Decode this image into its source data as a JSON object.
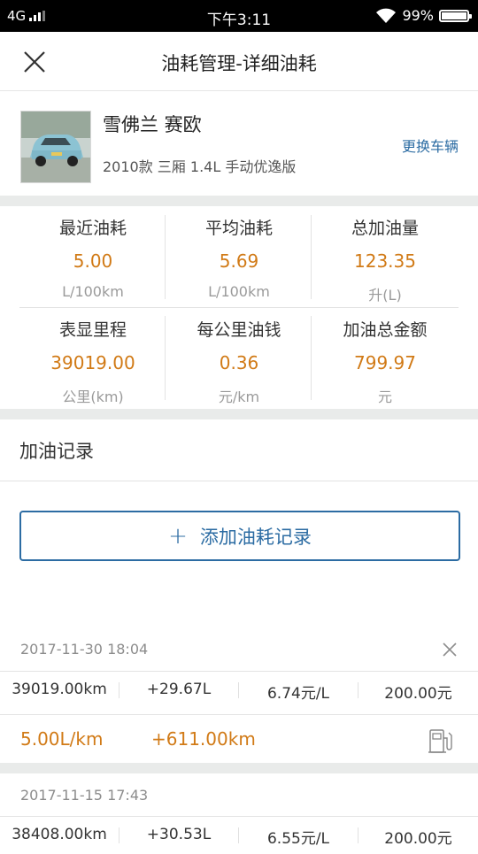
{
  "status_bar": {
    "network": "4G",
    "time": "下午3:11",
    "battery": "99%"
  },
  "header": {
    "title": "油耗管理-详细油耗"
  },
  "car": {
    "name": "雪佛兰 赛欧",
    "model": "2010款 三厢 1.4L 手动优逸版",
    "change_label": "更换车辆"
  },
  "stats": {
    "recent": {
      "label": "最近油耗",
      "value": "5.00",
      "unit": "L/100km"
    },
    "average": {
      "label": "平均油耗",
      "value": "5.69",
      "unit": "L/100km"
    },
    "total_fuel": {
      "label": "总加油量",
      "value": "123.35",
      "unit": "升(L)"
    },
    "odometer": {
      "label": "表显里程",
      "value": "39019.00",
      "unit": "公里(km)"
    },
    "cost_per_km": {
      "label": "每公里油钱",
      "value": "0.36",
      "unit": "元/km"
    },
    "total_amount": {
      "label": "加油总金额",
      "value": "799.97",
      "unit": "元"
    }
  },
  "records": {
    "title": "加油记录",
    "add_label": "添加油耗记录",
    "items": [
      {
        "datetime": "2017-11-30 18:04",
        "odometer": "39019.00km",
        "fuel": "+29.67L",
        "price": "6.74元/L",
        "amount": "200.00元",
        "consumption": "5.00L/km",
        "distance": "+611.00km"
      },
      {
        "datetime": "2017-11-15 17:43",
        "odometer": "38408.00km",
        "fuel": "+30.53L",
        "price": "6.55元/L",
        "amount": "200.00元"
      }
    ]
  },
  "colors": {
    "accent": "#2c6ca3",
    "value_orange": "#d17a16",
    "separator": "#e9ebea"
  }
}
